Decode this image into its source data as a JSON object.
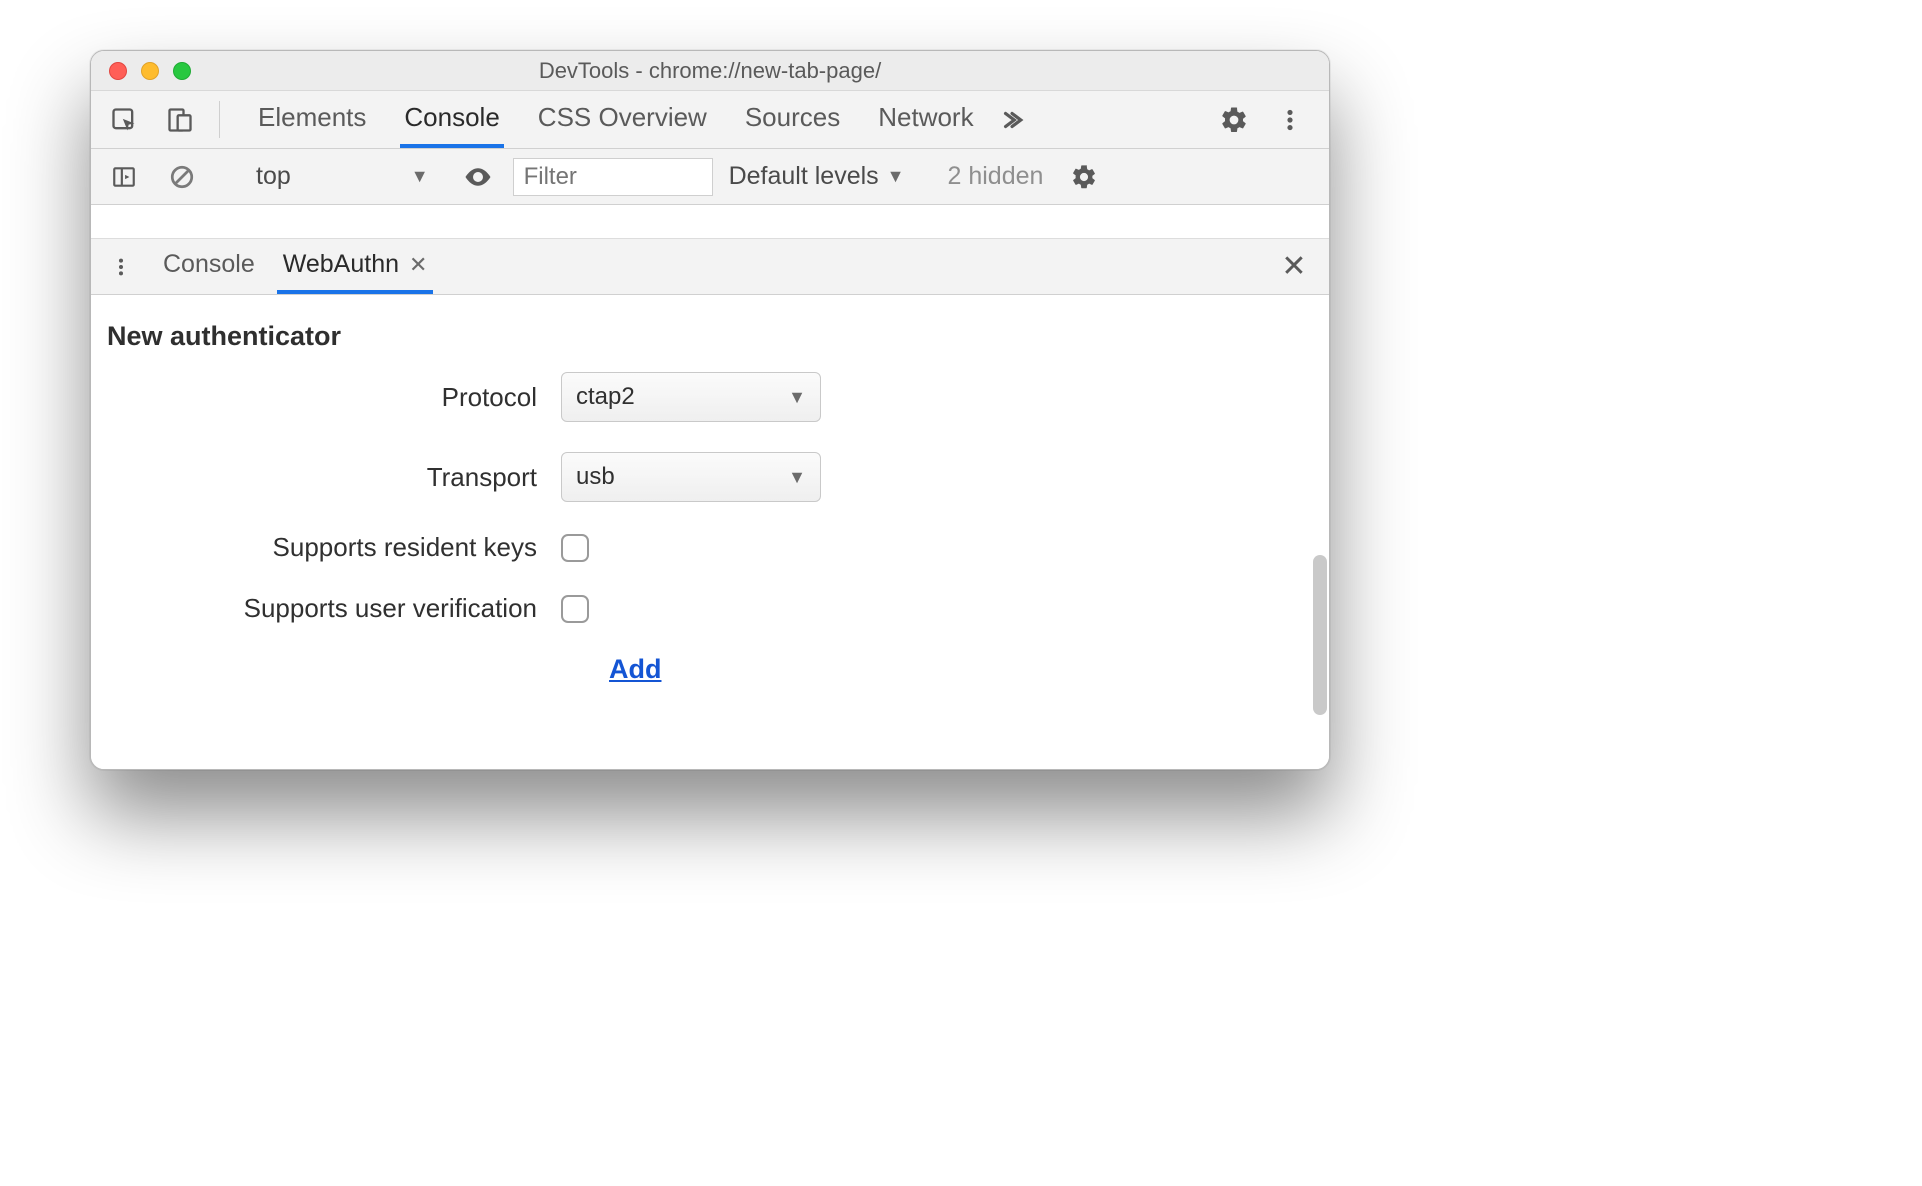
{
  "window": {
    "title": "DevTools - chrome://new-tab-page/"
  },
  "main_tabs": {
    "items": [
      "Elements",
      "Console",
      "CSS Overview",
      "Sources",
      "Network"
    ],
    "active_index": 1
  },
  "console_bar": {
    "context": "top",
    "filter_placeholder": "Filter",
    "levels": "Default levels",
    "hidden": "2 hidden"
  },
  "drawer_tabs": {
    "items": [
      "Console",
      "WebAuthn"
    ],
    "active_index": 1
  },
  "webauthn": {
    "heading": "New authenticator",
    "protocol_label": "Protocol",
    "protocol_value": "ctap2",
    "transport_label": "Transport",
    "transport_value": "usb",
    "resident_label": "Supports resident keys",
    "uv_label": "Supports user verification",
    "add_label": "Add"
  }
}
